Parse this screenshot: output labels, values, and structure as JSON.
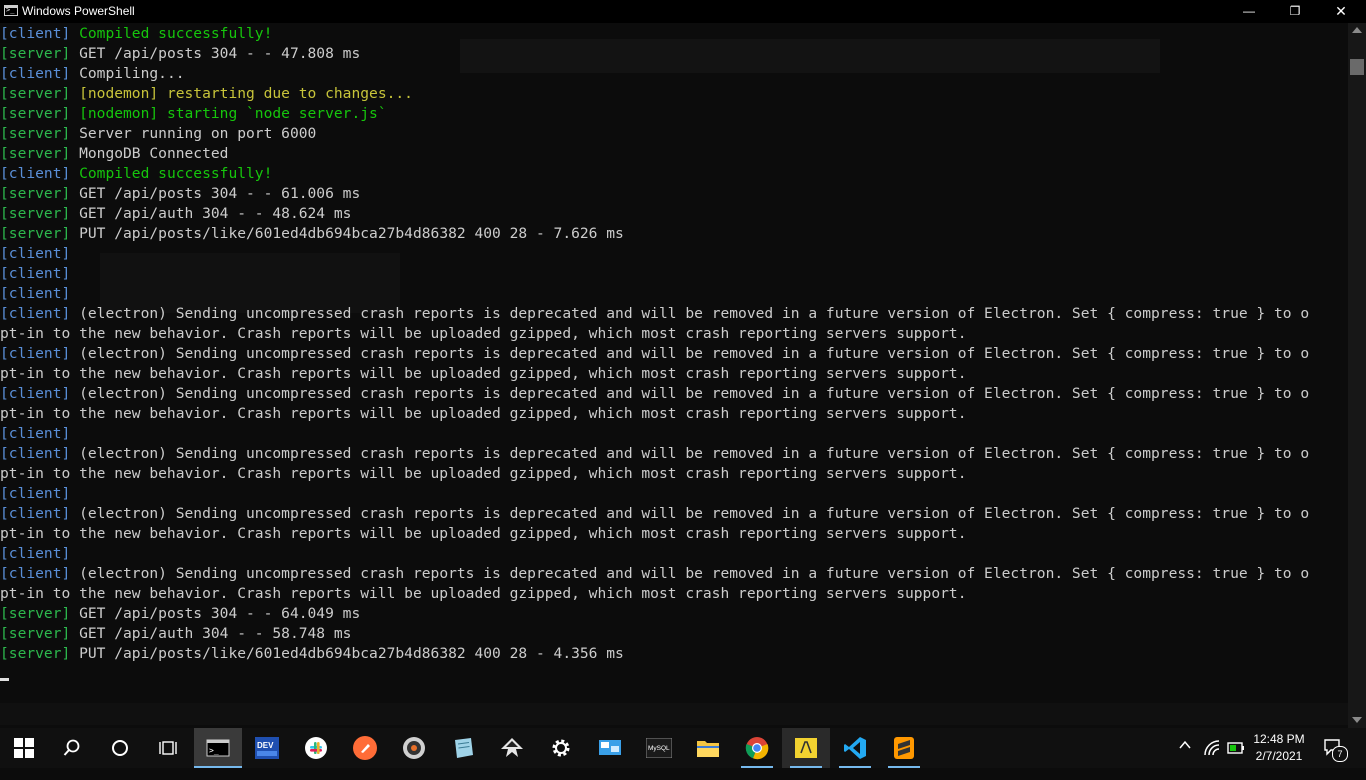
{
  "window": {
    "title": "Windows PowerShell",
    "minimize_glyph": "—",
    "maximize_glyph": "❐",
    "close_glyph": "✕"
  },
  "console": {
    "lines": [
      {
        "tag": "[client]",
        "tag_color": "client",
        "text": " Compiled successfully!",
        "text_color": "green"
      },
      {
        "tag": "[server]",
        "tag_color": "server",
        "text": " GET /api/posts 304 - - 47.808 ms",
        "text_color": "default"
      },
      {
        "tag": "[client]",
        "tag_color": "client",
        "text": " Compiling...",
        "text_color": "default"
      },
      {
        "tag": "[server]",
        "tag_color": "server",
        "text": " [nodemon] restarting due to changes...",
        "text_color": "yellow"
      },
      {
        "tag": "[server]",
        "tag_color": "server",
        "text": " [nodemon] starting `node server.js`",
        "text_color": "green"
      },
      {
        "tag": "[server]",
        "tag_color": "server",
        "text": " Server running on port 6000",
        "text_color": "default"
      },
      {
        "tag": "[server]",
        "tag_color": "server",
        "text": " MongoDB Connected",
        "text_color": "default"
      },
      {
        "tag": "[client]",
        "tag_color": "client",
        "text": " Compiled successfully!",
        "text_color": "green"
      },
      {
        "tag": "[server]",
        "tag_color": "server",
        "text": " GET /api/posts 304 - - 61.006 ms",
        "text_color": "default"
      },
      {
        "tag": "[server]",
        "tag_color": "server",
        "text": " GET /api/auth 304 - - 48.624 ms",
        "text_color": "default"
      },
      {
        "tag": "[server]",
        "tag_color": "server",
        "text": " PUT /api/posts/like/601ed4db694bca27b4d86382 400 28 - 7.626 ms",
        "text_color": "default"
      },
      {
        "tag": "[client]",
        "tag_color": "client",
        "text": "",
        "text_color": "default"
      },
      {
        "tag": "[client]",
        "tag_color": "client",
        "text": "",
        "text_color": "default"
      },
      {
        "tag": "[client]",
        "tag_color": "client",
        "text": "",
        "text_color": "default"
      },
      {
        "tag": "[client]",
        "tag_color": "client",
        "text": " (electron) Sending uncompressed crash reports is deprecated and will be removed in a future version of Electron. Set { compress: true } to o",
        "text_color": "default"
      },
      {
        "tag": "",
        "tag_color": "client",
        "text": "pt-in to the new behavior. Crash reports will be uploaded gzipped, which most crash reporting servers support.",
        "text_color": "default"
      },
      {
        "tag": "[client]",
        "tag_color": "client",
        "text": " (electron) Sending uncompressed crash reports is deprecated and will be removed in a future version of Electron. Set { compress: true } to o",
        "text_color": "default"
      },
      {
        "tag": "",
        "tag_color": "client",
        "text": "pt-in to the new behavior. Crash reports will be uploaded gzipped, which most crash reporting servers support.",
        "text_color": "default"
      },
      {
        "tag": "[client]",
        "tag_color": "client",
        "text": " (electron) Sending uncompressed crash reports is deprecated and will be removed in a future version of Electron. Set { compress: true } to o",
        "text_color": "default"
      },
      {
        "tag": "",
        "tag_color": "client",
        "text": "pt-in to the new behavior. Crash reports will be uploaded gzipped, which most crash reporting servers support.",
        "text_color": "default"
      },
      {
        "tag": "[client]",
        "tag_color": "client",
        "text": "",
        "text_color": "default"
      },
      {
        "tag": "[client]",
        "tag_color": "client",
        "text": " (electron) Sending uncompressed crash reports is deprecated and will be removed in a future version of Electron. Set { compress: true } to o",
        "text_color": "default"
      },
      {
        "tag": "",
        "tag_color": "client",
        "text": "pt-in to the new behavior. Crash reports will be uploaded gzipped, which most crash reporting servers support.",
        "text_color": "default"
      },
      {
        "tag": "[client]",
        "tag_color": "client",
        "text": "",
        "text_color": "default"
      },
      {
        "tag": "[client]",
        "tag_color": "client",
        "text": " (electron) Sending uncompressed crash reports is deprecated and will be removed in a future version of Electron. Set { compress: true } to o",
        "text_color": "default"
      },
      {
        "tag": "",
        "tag_color": "client",
        "text": "pt-in to the new behavior. Crash reports will be uploaded gzipped, which most crash reporting servers support.",
        "text_color": "default"
      },
      {
        "tag": "[client]",
        "tag_color": "client",
        "text": "",
        "text_color": "default"
      },
      {
        "tag": "[client]",
        "tag_color": "client",
        "text": " (electron) Sending uncompressed crash reports is deprecated and will be removed in a future version of Electron. Set { compress: true } to o",
        "text_color": "default"
      },
      {
        "tag": "",
        "tag_color": "client",
        "text": "pt-in to the new behavior. Crash reports will be uploaded gzipped, which most crash reporting servers support.",
        "text_color": "default"
      },
      {
        "tag": "[server]",
        "tag_color": "server",
        "text": " GET /api/posts 304 - - 64.049 ms",
        "text_color": "default"
      },
      {
        "tag": "[server]",
        "tag_color": "server",
        "text": " GET /api/auth 304 - - 58.748 ms",
        "text_color": "default"
      },
      {
        "tag": "[server]",
        "tag_color": "server",
        "text": " PUT /api/posts/like/601ed4db694bca27b4d86382 400 28 - 4.356 ms",
        "text_color": "default"
      }
    ]
  },
  "colors": {
    "client_tag": "#5a8fd8",
    "server_tag": "#2db84d",
    "success_green": "#16c60c",
    "nodemon_yellow": "#c7c43a",
    "console_bg": "#0c0c0c",
    "taskbar_bg": "#101010",
    "taskbar_accent": "#76b9ed"
  },
  "taskbar": {
    "items": [
      {
        "name": "start-button",
        "icon": "windows-logo-icon"
      },
      {
        "name": "search-button",
        "icon": "search-icon"
      },
      {
        "name": "cortana-button",
        "icon": "cortana-ring-icon"
      },
      {
        "name": "task-view-button",
        "icon": "task-view-icon"
      },
      {
        "name": "powershell-taskbar-button",
        "icon": "terminal-icon",
        "state": "active"
      },
      {
        "name": "devto-taskbar-button",
        "icon": "dev-icon",
        "label": "DEV"
      },
      {
        "name": "slack-taskbar-button",
        "icon": "slack-icon"
      },
      {
        "name": "postman-taskbar-button",
        "icon": "postman-icon"
      },
      {
        "name": "media-taskbar-button",
        "icon": "media-player-icon"
      },
      {
        "name": "notes-taskbar-button",
        "icon": "notes-icon"
      },
      {
        "name": "inkscape-taskbar-button",
        "icon": "inkscape-icon"
      },
      {
        "name": "settings-taskbar-button",
        "icon": "gear-icon"
      },
      {
        "name": "remote-taskbar-button",
        "icon": "remote-desktop-icon"
      },
      {
        "name": "mysql-taskbar-button",
        "icon": "mysql-icon",
        "label": "MySQL"
      },
      {
        "name": "explorer-taskbar-button",
        "icon": "folder-icon"
      },
      {
        "name": "chrome-taskbar-button",
        "icon": "chrome-icon",
        "state": "running"
      },
      {
        "name": "snipping-taskbar-button",
        "icon": "snip-icon",
        "state": "running"
      },
      {
        "name": "vscode-taskbar-button",
        "icon": "vscode-icon",
        "state": "running"
      },
      {
        "name": "sublime-taskbar-button",
        "icon": "sublime-icon",
        "state": "running"
      }
    ],
    "tray": {
      "chevron": "^",
      "time": "12:48 PM",
      "date": "2/7/2021",
      "notification_count": "7"
    }
  }
}
